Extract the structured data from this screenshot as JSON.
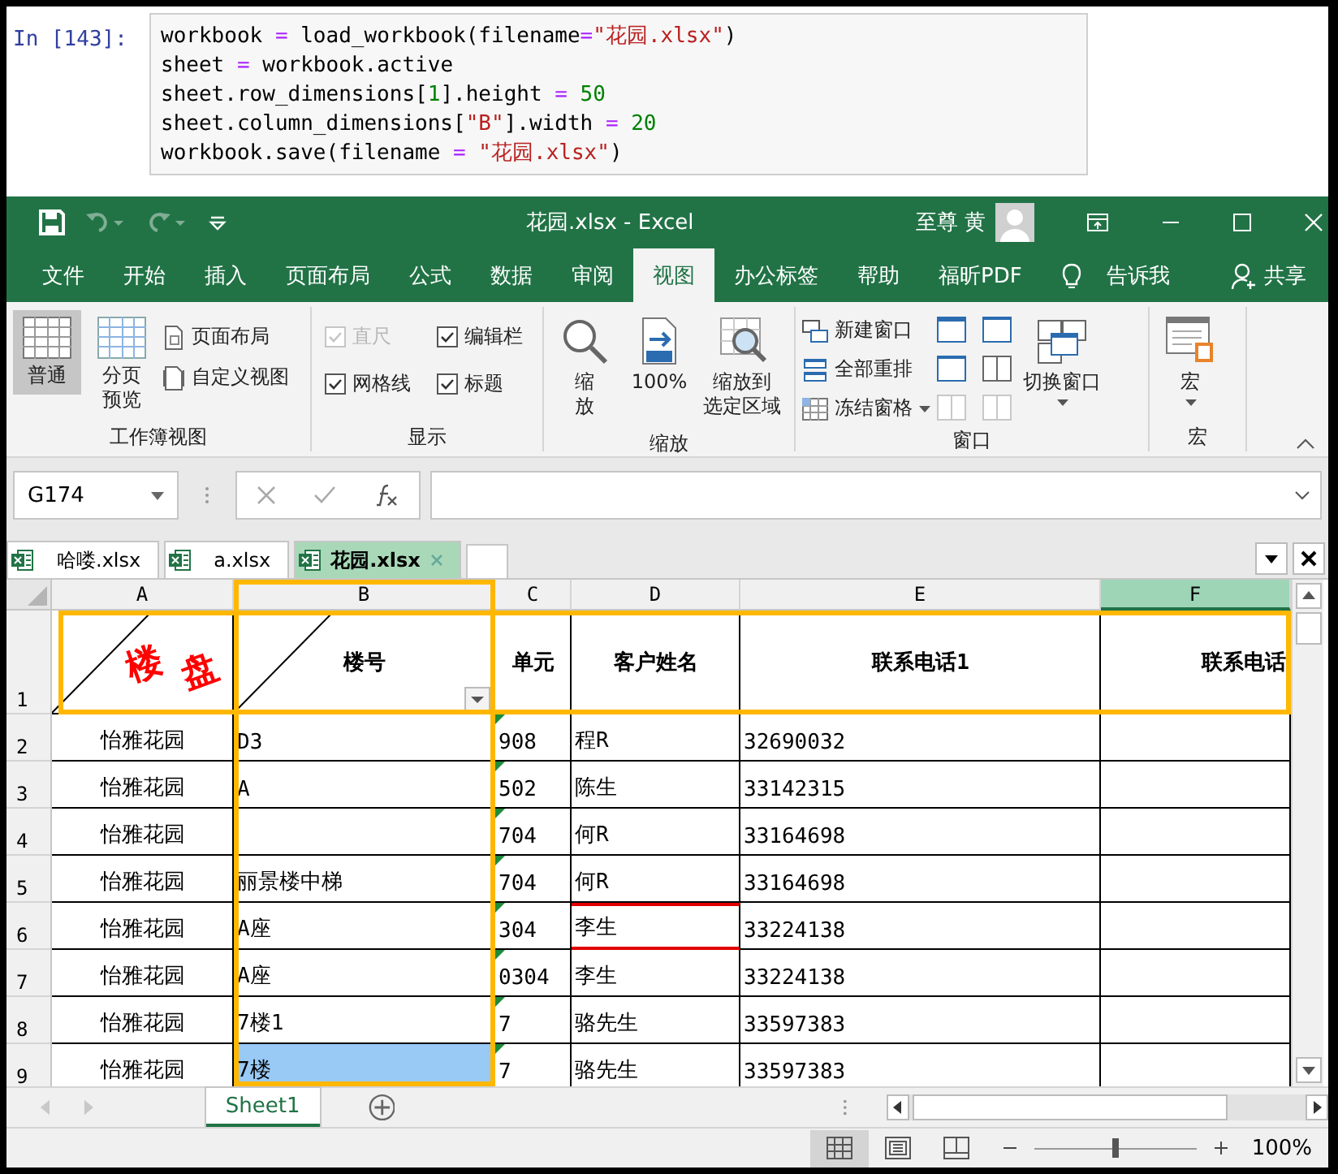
{
  "notebook": {
    "prompt": "In [143]:",
    "code_lines": [
      [
        {
          "kind": "name",
          "text": "workbook "
        },
        {
          "kind": "op",
          "text": "="
        },
        {
          "kind": "name",
          "text": " load_workbook(filename"
        },
        {
          "kind": "op",
          "text": "="
        },
        {
          "kind": "string",
          "text": "\"花园.xlsx\""
        },
        {
          "kind": "name",
          "text": ")"
        }
      ],
      [
        {
          "kind": "name",
          "text": "sheet "
        },
        {
          "kind": "op",
          "text": "="
        },
        {
          "kind": "name",
          "text": " workbook.active"
        }
      ],
      [
        {
          "kind": "name",
          "text": "sheet.row_dimensions["
        },
        {
          "kind": "number",
          "text": "1"
        },
        {
          "kind": "name",
          "text": "].height "
        },
        {
          "kind": "op",
          "text": "="
        },
        {
          "kind": "number",
          "text": " 50"
        }
      ],
      [
        {
          "kind": "name",
          "text": "sheet.column_dimensions["
        },
        {
          "kind": "string",
          "text": "\"B\""
        },
        {
          "kind": "name",
          "text": "].width "
        },
        {
          "kind": "op",
          "text": "="
        },
        {
          "kind": "number",
          "text": " 20"
        }
      ],
      [
        {
          "kind": "name",
          "text": "workbook.save(filename "
        },
        {
          "kind": "op",
          "text": "="
        },
        {
          "kind": "string",
          "text": " \"花园.xlsx\""
        },
        {
          "kind": "name",
          "text": ")"
        }
      ]
    ]
  },
  "title_bar": {
    "title": "花园.xlsx - Excel",
    "user": "至尊 黄"
  },
  "ribbon_tabs": [
    {
      "label": "文件",
      "selected": false
    },
    {
      "label": "开始",
      "selected": false
    },
    {
      "label": "插入",
      "selected": false
    },
    {
      "label": "页面布局",
      "selected": false
    },
    {
      "label": "公式",
      "selected": false
    },
    {
      "label": "数据",
      "selected": false
    },
    {
      "label": "审阅",
      "selected": false
    },
    {
      "label": "视图",
      "selected": true
    },
    {
      "label": "办公标签",
      "selected": false
    },
    {
      "label": "帮助",
      "selected": false
    },
    {
      "label": "福昕PDF",
      "selected": false
    }
  ],
  "tell_me": "告诉我",
  "share": "共享",
  "workbook_views": {
    "label": "工作簿视图",
    "large": [
      {
        "label": "普通",
        "selected": true
      },
      {
        "label": "分页预览",
        "selected": false
      }
    ],
    "small": [
      {
        "label": "页面布局"
      },
      {
        "label": "自定义视图"
      }
    ]
  },
  "show": {
    "label": "显示",
    "checkboxes": [
      {
        "label": "直尺",
        "checked": true,
        "disabled": true
      },
      {
        "label": "编辑栏",
        "checked": true,
        "disabled": false
      },
      {
        "label": "网格线",
        "checked": true,
        "disabled": false
      },
      {
        "label": "标题",
        "checked": true,
        "disabled": false
      }
    ]
  },
  "zoom_group": {
    "label": "缩放",
    "buttons": [
      {
        "label": "缩放"
      },
      {
        "label": "100%"
      },
      {
        "label": "缩放到选定区域"
      }
    ]
  },
  "window_group": {
    "label": "窗口",
    "buttons": [
      {
        "label": "新建窗口",
        "dropdown": false
      },
      {
        "label": "全部重排",
        "dropdown": false
      },
      {
        "label": "冻结窗格",
        "dropdown": true
      }
    ],
    "icon_buttons": [
      {
        "disabled": false
      },
      {
        "disabled": false
      },
      {
        "disabled": false
      },
      {
        "disabled": false
      },
      {
        "disabled": true
      },
      {
        "disabled": true
      }
    ],
    "switch": {
      "label": "切换窗口",
      "dropdown": true
    }
  },
  "macro_group": {
    "label": "宏",
    "button": {
      "label": "宏",
      "dropdown": true
    }
  },
  "formula_bar": {
    "name_box": "G174"
  },
  "workbook_tabs": [
    {
      "label": "哈喽.xlsx",
      "selected": false
    },
    {
      "label": "a.xlsx",
      "selected": false
    },
    {
      "label": "花园.xlsx",
      "selected": true
    }
  ],
  "sheet": {
    "columns": [
      {
        "label": "A",
        "selected": false,
        "highlighted": false
      },
      {
        "label": "B",
        "selected": false,
        "highlighted": true
      },
      {
        "label": "C",
        "selected": false,
        "highlighted": false
      },
      {
        "label": "D",
        "selected": false,
        "highlighted": false
      },
      {
        "label": "E",
        "selected": false,
        "highlighted": false
      },
      {
        "label": "F",
        "selected": true,
        "highlighted": false
      }
    ],
    "rows": [
      {
        "label": "1",
        "highlighted": true,
        "cells": [
          {
            "wordart": [
              "楼",
              "盘"
            ],
            "diagonal": true,
            "selected": false
          },
          {
            "text": "楼号",
            "diagonal": true,
            "filter": true,
            "selected": false
          },
          {
            "text": "单元",
            "selected": false
          },
          {
            "text": "客户姓名",
            "selected": false
          },
          {
            "text": "联系电话1",
            "selected": false
          },
          {
            "text": "联系电话",
            "selected": false
          }
        ]
      },
      {
        "label": "2",
        "highlighted": false,
        "cells": [
          {
            "text": "怡雅花园",
            "selected": false
          },
          {
            "text": "D3",
            "selected": false
          },
          {
            "text": "908",
            "error_marker": true,
            "selected": false
          },
          {
            "text": "程R",
            "selected": false
          },
          {
            "text": "32690032",
            "selected": false
          },
          {
            "selected": false
          }
        ]
      },
      {
        "label": "3",
        "highlighted": false,
        "cells": [
          {
            "text": "怡雅花园",
            "selected": false
          },
          {
            "text": "A",
            "selected": false
          },
          {
            "text": "502",
            "error_marker": true,
            "selected": false
          },
          {
            "text": "陈生",
            "selected": false
          },
          {
            "text": "33142315",
            "selected": false
          },
          {
            "selected": false
          }
        ]
      },
      {
        "label": "4",
        "highlighted": false,
        "cells": [
          {
            "text": "怡雅花园",
            "selected": false
          },
          {
            "selected": false
          },
          {
            "text": "704",
            "error_marker": true,
            "selected": false
          },
          {
            "text": "何R",
            "selected": false
          },
          {
            "text": "33164698",
            "selected": false
          },
          {
            "selected": false
          }
        ]
      },
      {
        "label": "5",
        "highlighted": false,
        "cells": [
          {
            "text": "怡雅花园",
            "selected": false
          },
          {
            "text": "丽景楼中梯",
            "selected": false
          },
          {
            "text": "704",
            "error_marker": true,
            "selected": false
          },
          {
            "text": "何R",
            "selected": false
          },
          {
            "text": "33164698",
            "selected": false
          },
          {
            "selected": false
          }
        ]
      },
      {
        "label": "6",
        "highlighted": false,
        "cells": [
          {
            "text": "怡雅花园",
            "selected": false
          },
          {
            "text": "A座",
            "selected": false
          },
          {
            "text": "304",
            "error_marker": true,
            "selected": false
          },
          {
            "text": "李生",
            "flagged": true,
            "selected": false
          },
          {
            "text": "33224138",
            "selected": false
          },
          {
            "selected": false
          }
        ]
      },
      {
        "label": "7",
        "highlighted": false,
        "cells": [
          {
            "text": "怡雅花园",
            "selected": false
          },
          {
            "text": "A座",
            "selected": false
          },
          {
            "text": "0304",
            "error_marker": true,
            "selected": false
          },
          {
            "text": "李生",
            "selected": false
          },
          {
            "text": "33224138",
            "selected": false
          },
          {
            "selected": false
          }
        ]
      },
      {
        "label": "8",
        "highlighted": false,
        "cells": [
          {
            "text": "怡雅花园",
            "selected": false
          },
          {
            "text": "7楼1",
            "selected": false
          },
          {
            "text": "7",
            "error_marker": true,
            "selected": false
          },
          {
            "text": "骆先生",
            "selected": false
          },
          {
            "text": "33597383",
            "selected": false
          },
          {
            "selected": false
          }
        ]
      },
      {
        "label": "9",
        "highlighted": false,
        "cells": [
          {
            "text": "怡雅花园",
            "selected": false
          },
          {
            "text": "7楼",
            "selected": true
          },
          {
            "text": "7",
            "error_marker": true,
            "selected": false
          },
          {
            "text": "骆先生",
            "selected": false
          },
          {
            "text": "33597383",
            "selected": false
          },
          {
            "selected": false
          }
        ]
      }
    ]
  },
  "sheet_tabs": [
    {
      "label": "Sheet1",
      "selected": true
    }
  ],
  "status_bar": {
    "views": [
      {
        "selected": true
      },
      {
        "selected": false
      },
      {
        "selected": false
      }
    ],
    "zoom": {
      "level": 0.5,
      "label": "100%"
    }
  }
}
